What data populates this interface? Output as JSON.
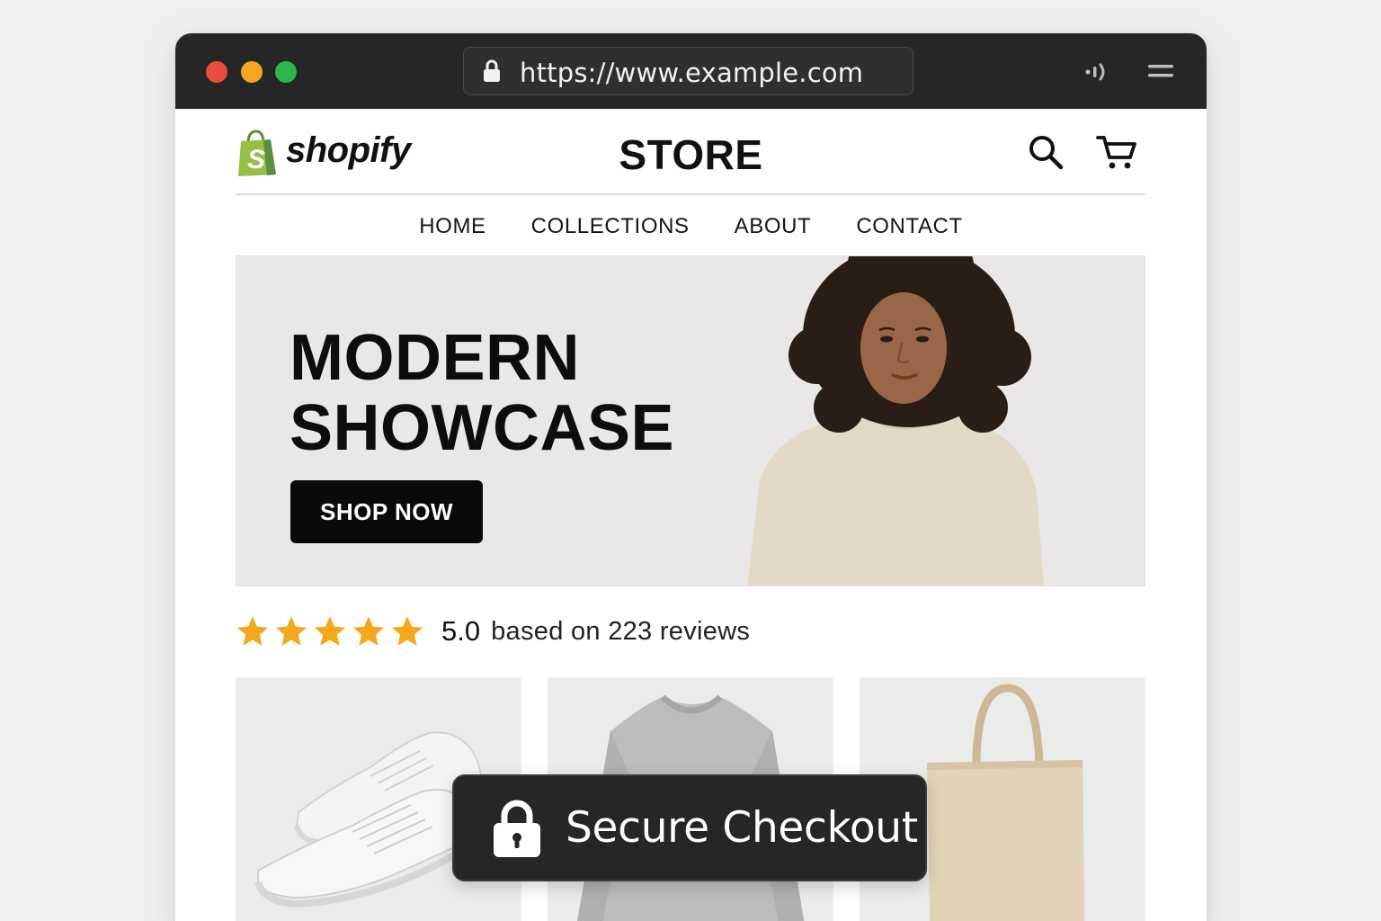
{
  "browser": {
    "url": "https://www.example.com",
    "window_controls": [
      "close",
      "minimize",
      "maximize"
    ],
    "icons": [
      "lock-icon",
      "audio-icon",
      "menu-icon"
    ]
  },
  "header": {
    "logo_text": "shopify",
    "store_title": "STORE",
    "icons": [
      "search-icon",
      "cart-icon"
    ]
  },
  "nav": {
    "items": [
      {
        "label": "HOME"
      },
      {
        "label": "COLLECTIONS"
      },
      {
        "label": "ABOUT"
      },
      {
        "label": "CONTACT"
      }
    ]
  },
  "hero": {
    "title_line1": "MODERN",
    "title_line2": "SHOWCASE",
    "cta_label": "SHOP NOW"
  },
  "rating": {
    "stars": 5,
    "score": "5.0",
    "text": "based on 223 reviews"
  },
  "products": [
    {
      "image": "white-sneakers"
    },
    {
      "image": "gray-sweatshirt"
    },
    {
      "image": "canvas-tote-bag"
    }
  ],
  "badge": {
    "label": "Secure Checkout"
  },
  "colors": {
    "titlebar": "#262626",
    "shopify_green": "#95bf47",
    "star": "#f5a81c",
    "cta_bg": "#0a0a0a",
    "hero_bg": "#e9e8e6"
  }
}
